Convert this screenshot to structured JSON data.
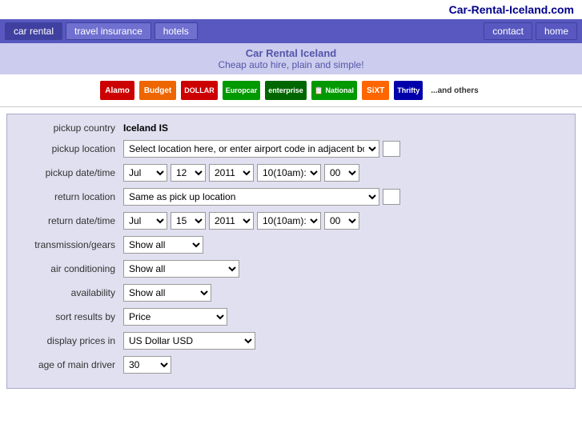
{
  "site": {
    "name": "Car-Rental-Iceland.com"
  },
  "nav": {
    "items": [
      {
        "label": "car rental",
        "active": true
      },
      {
        "label": "travel insurance",
        "active": false
      },
      {
        "label": "hotels",
        "active": false
      }
    ],
    "right_items": [
      {
        "label": "contact"
      },
      {
        "label": "home"
      }
    ]
  },
  "page_title": {
    "line1": "Car Rental Iceland",
    "line2": "Cheap auto hire, plain and simple!"
  },
  "brands": [
    {
      "name": "Alamo",
      "class": "brand-alamo"
    },
    {
      "name": "Budget",
      "class": "brand-budget"
    },
    {
      "name": "DOLLAR",
      "class": "brand-dollar"
    },
    {
      "name": "Europcar",
      "class": "brand-europcar"
    },
    {
      "name": "enterprise",
      "class": "brand-enterprise"
    },
    {
      "name": "National",
      "class": "brand-national"
    },
    {
      "name": "SiXT",
      "class": "brand-sixt"
    },
    {
      "name": "Thrifty",
      "class": "brand-thrifty"
    },
    {
      "name": "...and others",
      "class": "brand-others"
    }
  ],
  "form": {
    "pickup_country_label": "pickup country",
    "pickup_country_value": "Iceland IS",
    "pickup_location_label": "pickup location",
    "pickup_location_placeholder": "Select location here, or enter airport code in adjacent box >",
    "pickup_datetime_label": "pickup date/time",
    "pickup_month": "Jul",
    "pickup_day": "12",
    "pickup_year": "2011",
    "pickup_hour": "10(10am):",
    "pickup_min": "00",
    "return_location_label": "return location",
    "return_location_value": "Same as pick up location",
    "return_datetime_label": "return date/time",
    "return_month": "Jul",
    "return_day": "15",
    "return_year": "2011",
    "return_hour": "10(10am):",
    "return_min": "00",
    "transmission_label": "transmission/gears",
    "transmission_value": "Show all",
    "aircon_label": "air conditioning",
    "aircon_value": "Show all",
    "availability_label": "availability",
    "availability_value": "Show all",
    "sort_label": "sort results by",
    "sort_value": "Price",
    "currency_label": "display prices in",
    "currency_value": "US Dollar USD",
    "age_label": "age of main driver",
    "age_value": "30"
  }
}
